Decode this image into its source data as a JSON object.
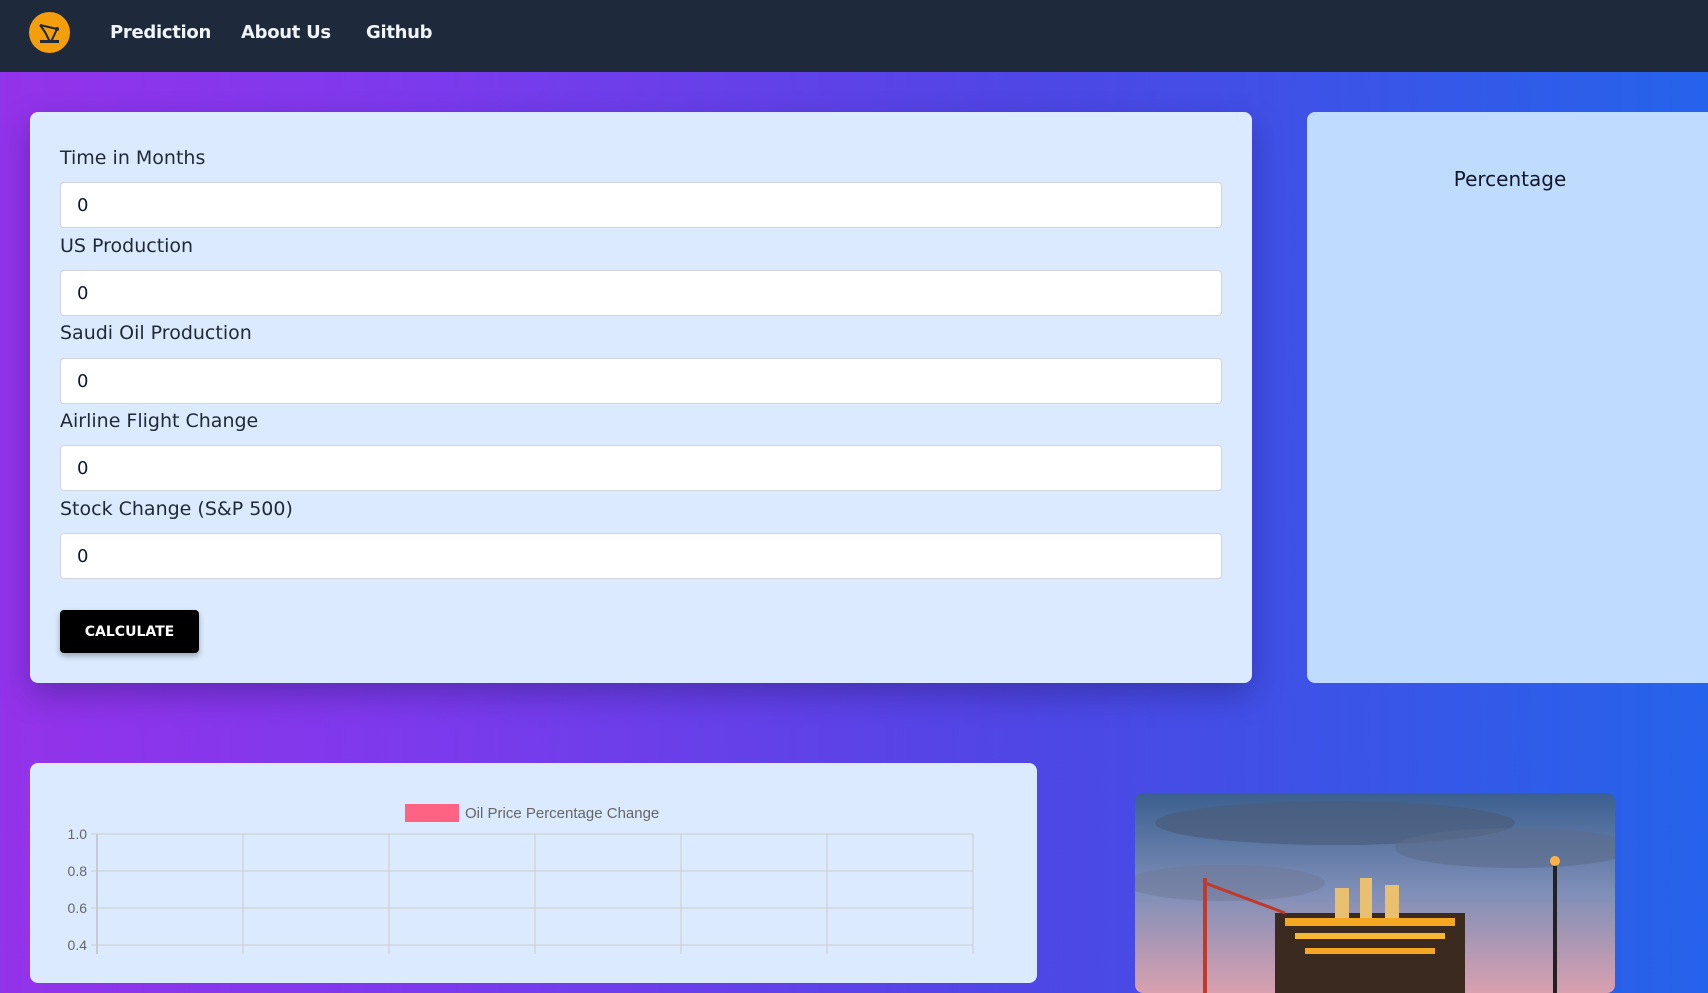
{
  "nav": {
    "logo_alt": "oil pump logo",
    "links": [
      "Prediction",
      "About Us",
      "Github"
    ]
  },
  "form": {
    "fields": [
      {
        "label": "Time in Months",
        "value": "0"
      },
      {
        "label": "US Production",
        "value": "0"
      },
      {
        "label": "Saudi Oil Production",
        "value": "0"
      },
      {
        "label": "Airline Flight Change",
        "value": "0"
      },
      {
        "label": "Stock Change (S&P 500)",
        "value": "0"
      }
    ],
    "button_label": "CALCULATE"
  },
  "result": {
    "title": "Percentage"
  },
  "chart_data": {
    "type": "bar",
    "legend": [
      "Oil Price Percentage Change"
    ],
    "legend_color": "#ff6384",
    "series": [
      {
        "name": "Oil Price Percentage Change",
        "values": []
      }
    ],
    "y_ticks": [
      "1.0",
      "0.8",
      "0.6",
      "0.4"
    ],
    "ylim": [
      0,
      1.0
    ],
    "grid": true,
    "legend_position": "top"
  },
  "image": {
    "alt": "offshore oil platform at dusk"
  },
  "colors": {
    "navbar": "#1e293b",
    "card": "#dbeafe",
    "result_card": "#bfdbfe",
    "button": "#000000",
    "logo": "#f59e0b"
  }
}
